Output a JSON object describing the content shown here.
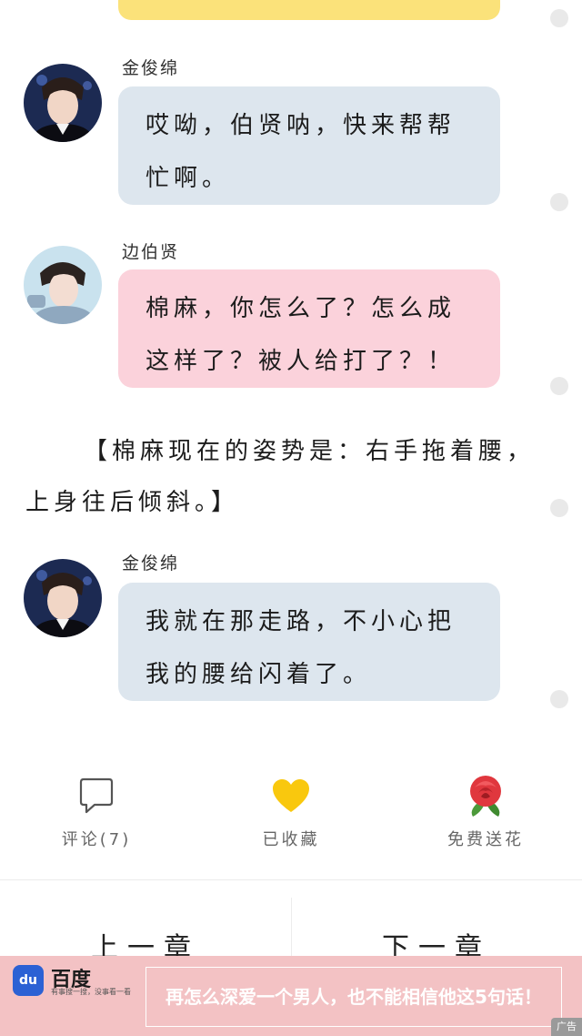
{
  "messages": [
    {
      "speaker": "金俊绵",
      "text": "哎呦，伯贤呐，快来帮帮忙啊。",
      "style": "blue",
      "avatar": "suho-avatar"
    },
    {
      "speaker": "边伯贤",
      "text": "棉麻，你怎么了？怎么成这样了？被人给打了？！",
      "style": "pink",
      "avatar": "baekhyun-avatar"
    },
    {
      "speaker": "金俊绵",
      "text": "我就在那走路，不小心把我的腰给闪着了。",
      "style": "blue",
      "avatar": "suho-avatar"
    }
  ],
  "narration": "【棉麻现在的姿势是：右手拖着腰，上身往后倾斜。】",
  "actions": {
    "comment_label": "评论(7)",
    "collect_label": "已收藏",
    "flower_label": "免费送花"
  },
  "nav": {
    "prev_label": "上一章",
    "next_label": "下一章"
  },
  "ad": {
    "logo_text": "du",
    "brand": "百度",
    "tagline": "有事搜一搜，没事看一看",
    "text": "再怎么深爱一个男人，也不能相信他这5句话！",
    "corner_label": "广告"
  },
  "colors": {
    "blue_bubble": "#dde6ee",
    "pink_bubble": "#fbd2db",
    "yellow_bubble": "#fbe27a",
    "heart": "#f9c80e",
    "ad_background": "#f3c2c4"
  },
  "icons": {
    "comment": "speech-bubble-icon",
    "collect": "heart-icon",
    "flower": "rose-icon"
  }
}
